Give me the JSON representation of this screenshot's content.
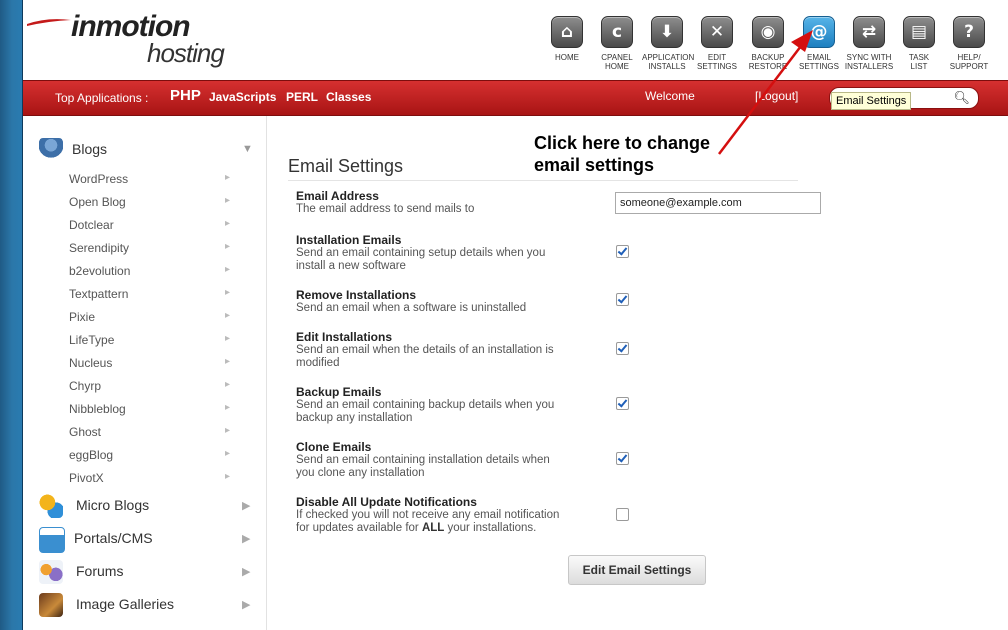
{
  "brand": {
    "line1": "inmotion",
    "line2": "hosting"
  },
  "toolbar": [
    {
      "label1": "HOME",
      "label2": "",
      "icon": "home-icon",
      "glyph": "⌂"
    },
    {
      "label1": "CPANEL",
      "label2": "HOME",
      "icon": "cpanel-icon",
      "glyph": "c"
    },
    {
      "label1": "APPLICATION",
      "label2": "INSTALLS",
      "icon": "download-icon",
      "glyph": "⬇"
    },
    {
      "label1": "EDIT",
      "label2": "SETTINGS",
      "icon": "tools-icon",
      "glyph": "✕"
    },
    {
      "label1": "BACKUP",
      "label2": "RESTORE",
      "icon": "backup-icon",
      "glyph": "◉"
    },
    {
      "label1": "EMAIL",
      "label2": "SETTINGS",
      "icon": "email-at-icon",
      "glyph": "@"
    },
    {
      "label1": "SYNC WITH",
      "label2": "INSTALLERS",
      "icon": "sync-icon",
      "glyph": "⇄"
    },
    {
      "label1": "TASK",
      "label2": "LIST",
      "icon": "clipboard-icon",
      "glyph": "▤"
    },
    {
      "label1": "HELP/",
      "label2": "SUPPORT",
      "icon": "help-icon",
      "glyph": "?"
    }
  ],
  "topbar": {
    "label": "Top Applications :",
    "apps": [
      "PHP",
      "JavaScripts",
      "PERL",
      "Classes"
    ],
    "welcome": "Welcome",
    "logout": "[Logout]",
    "search_placeholder": "Search"
  },
  "tooltip": "Email Settings",
  "sidebar": {
    "blogs": {
      "label": "Blogs",
      "items": [
        "WordPress",
        "Open Blog",
        "Dotclear",
        "Serendipity",
        "b2evolution",
        "Textpattern",
        "Pixie",
        "LifeType",
        "Nucleus",
        "Chyrp",
        "Nibbleblog",
        "Ghost",
        "eggBlog",
        "PivotX"
      ]
    },
    "categories": [
      "Micro Blogs",
      "Portals/CMS",
      "Forums",
      "Image Galleries"
    ]
  },
  "main": {
    "title": "Email Settings",
    "email_address": {
      "title": "Email Address",
      "desc": "The email address to send mails to",
      "value": "someone@example.com"
    },
    "settings": [
      {
        "title": "Installation Emails",
        "desc1": "Send an email containing setup details when you",
        "desc2": "install a new software",
        "checked": true
      },
      {
        "title": "Remove Installations",
        "desc1": "Send an email when a software is uninstalled",
        "desc2": "",
        "checked": true
      },
      {
        "title": "Edit Installations",
        "desc1": "Send an email when the details of an installation is",
        "desc2": "modified",
        "checked": true
      },
      {
        "title": "Backup Emails",
        "desc1": "Send an email containing backup details when you",
        "desc2": "backup any installation",
        "checked": true
      },
      {
        "title": "Clone Emails",
        "desc1": "Send an email containing installation details when",
        "desc2": "you clone any installation",
        "checked": true
      }
    ],
    "disable": {
      "title": "Disable All Update Notifications",
      "desc1": "If checked you will not receive any email notification",
      "desc2a": "for updates available for ",
      "desc2b": "ALL",
      "desc2c": " your installations.",
      "checked": false
    },
    "button": "Edit Email Settings"
  },
  "annotation": {
    "line1": "Click here to change",
    "line2": "email settings"
  },
  "colors": {
    "redbar": "#c21e1e",
    "accent": "#2b8fd2",
    "arrow": "#d40f0f"
  }
}
